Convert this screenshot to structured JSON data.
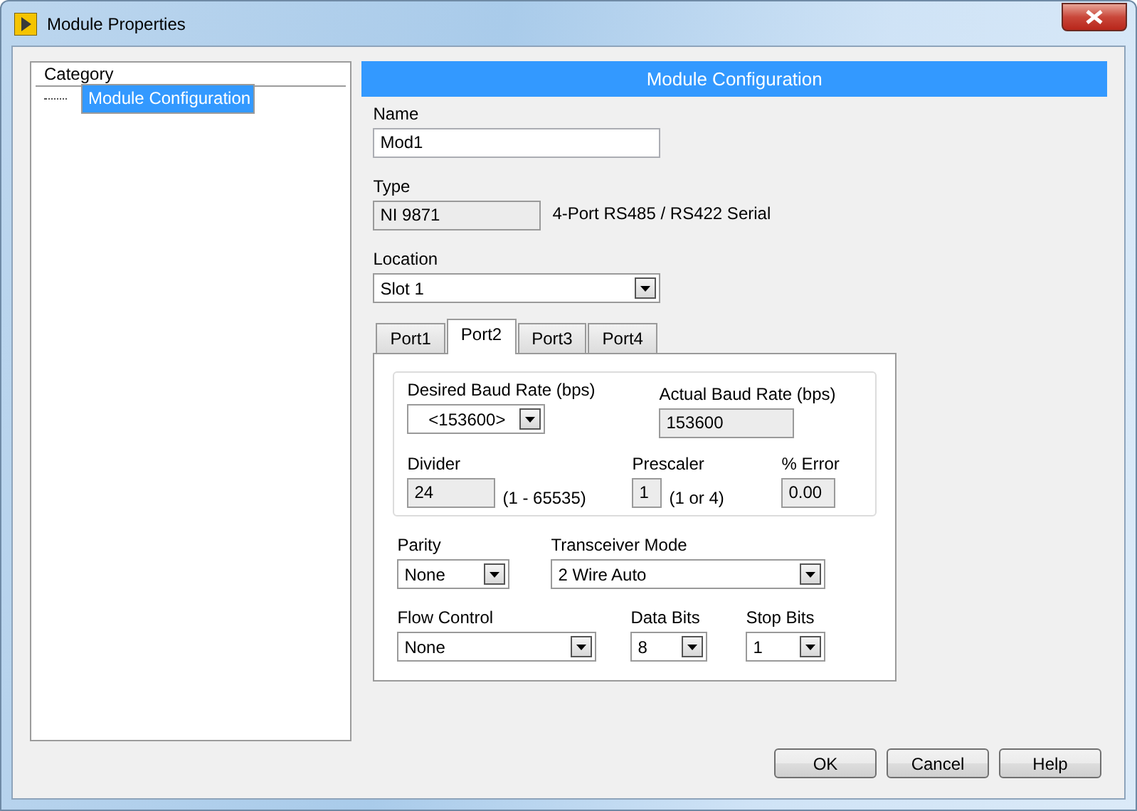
{
  "window": {
    "title": "Module Properties"
  },
  "category": {
    "header": "Category",
    "items": [
      {
        "label": "Module Configuration",
        "selected": true
      }
    ]
  },
  "section_title": "Module Configuration",
  "name": {
    "label": "Name",
    "value": "Mod1"
  },
  "type": {
    "label": "Type",
    "value": "NI 9871",
    "description": "4-Port RS485 / RS422 Serial"
  },
  "location": {
    "label": "Location",
    "value": "Slot 1"
  },
  "tabs": [
    {
      "label": "Port1",
      "selected": false
    },
    {
      "label": "Port2",
      "selected": true
    },
    {
      "label": "Port3",
      "selected": false
    },
    {
      "label": "Port4",
      "selected": false
    }
  ],
  "desired_baud_rate": {
    "label": "Desired Baud Rate (bps)",
    "value": "<153600>"
  },
  "actual_baud_rate": {
    "label": "Actual Baud Rate (bps)",
    "value": "153600"
  },
  "divider": {
    "label": "Divider",
    "value": "24",
    "range": "(1 - 65535)"
  },
  "prescaler": {
    "label": "Prescaler",
    "value": "1",
    "range": "(1 or 4)"
  },
  "error": {
    "label": "% Error",
    "value": "0.00"
  },
  "parity": {
    "label": "Parity",
    "value": "None"
  },
  "transceiver_mode": {
    "label": "Transceiver Mode",
    "value": "2 Wire Auto"
  },
  "flow_control": {
    "label": "Flow Control",
    "value": "None"
  },
  "data_bits": {
    "label": "Data Bits",
    "value": "8"
  },
  "stop_bits": {
    "label": "Stop Bits",
    "value": "1"
  },
  "buttons": [
    "OK",
    "Cancel",
    "Help"
  ]
}
